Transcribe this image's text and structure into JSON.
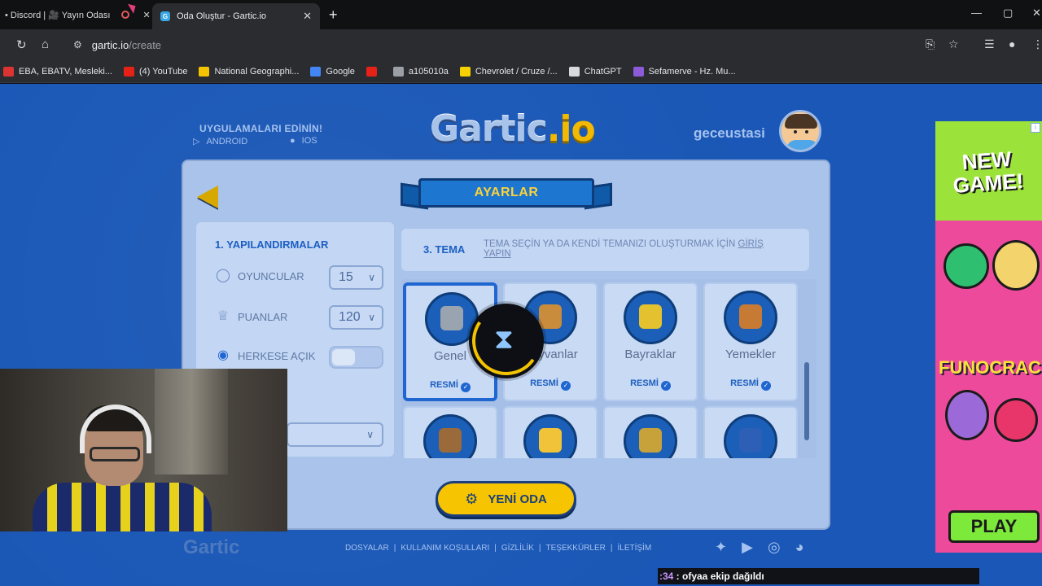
{
  "browser": {
    "tab_inactive_label": "• Discord | 🎥 Yayın Odası",
    "tab_active_title": "Oda Oluştur - Gartic.io",
    "tab_favicon_letter": "G",
    "new_tab_symbol": "+",
    "url_host": "gartic.io",
    "url_path": "/create",
    "window_controls": [
      "—",
      "▢",
      "✕"
    ]
  },
  "bookmarks": [
    {
      "label": "EBA, EBATV, Mesleki...",
      "color": "#d33"
    },
    {
      "label": "(4) YouTube",
      "color": "#e62117"
    },
    {
      "label": "National Geographi...",
      "color": "#f5c400"
    },
    {
      "label": "Google",
      "color": "#4285f4"
    },
    {
      "label": "",
      "color": "#e62117"
    },
    {
      "label": "a105010a",
      "color": "#9aa0a6"
    },
    {
      "label": "Chevrolet / Cruze /...",
      "color": "#f5d100"
    },
    {
      "label": "ChatGPT",
      "color": "#d7d9dc"
    },
    {
      "label": "Sefamerve - Hz. Mu...",
      "color": "#8e5bd8"
    }
  ],
  "header": {
    "apps_title": "UYGULAMALARI EDİNİN!",
    "android_label": "ANDROID",
    "ios_label": "IOS",
    "logo_main": "Gartic",
    "logo_suffix": ".io",
    "username": "geceustasi"
  },
  "panel": {
    "title": "AYARLAR",
    "config_title": "1. YAPILANDIRMALAR",
    "players_label": "OYUNCULAR",
    "players_value": "15",
    "points_label": "PUANLAR",
    "points_value": "120",
    "public_label": "HERKESE AÇIK",
    "theme_title": "3. TEMA",
    "theme_hint": "TEMA SEÇİN YA DA KENDİ TEMANIZI OLUŞTURMAK İÇİN",
    "theme_hint_link": "GİRİŞ YAPIN",
    "create_button": "YENİ ODA"
  },
  "themes": [
    {
      "name": "Genel",
      "badge": "RESMİ",
      "selected": true,
      "icon": "#9aa4b1"
    },
    {
      "name": "Hayvanlar",
      "badge": "RESMİ",
      "selected": false,
      "icon": "#c98b3c"
    },
    {
      "name": "Bayraklar",
      "badge": "RESMİ",
      "selected": false,
      "icon": "#e4c12f"
    },
    {
      "name": "Yemekler",
      "badge": "RESMİ",
      "selected": false,
      "icon": "#c77a34"
    },
    {
      "name": "",
      "badge": "",
      "selected": false,
      "icon": "#9a6a3a"
    },
    {
      "name": "",
      "badge": "",
      "selected": false,
      "icon": "#f0c338"
    },
    {
      "name": "",
      "badge": "",
      "selected": false,
      "icon": "#c7a23a"
    },
    {
      "name": "",
      "badge": "",
      "selected": false,
      "icon": "#2d5fb6"
    }
  ],
  "footer": {
    "logo": "Gartic",
    "links": [
      "DOSYALAR",
      "|",
      "KULLANIM KOŞULLARI",
      "|",
      "GİZLİLİK",
      "|",
      "TEŞEKKÜRLER",
      "|",
      "İLETİŞİM"
    ]
  },
  "ad": {
    "headline": "NEW GAME!",
    "brand": "FUNOCRACY",
    "cta": "PLAY",
    "info_icon": "i"
  },
  "stream_overlay": {
    "timestamp": ":34",
    "message": " : ofyaa ekip dağıldı"
  }
}
